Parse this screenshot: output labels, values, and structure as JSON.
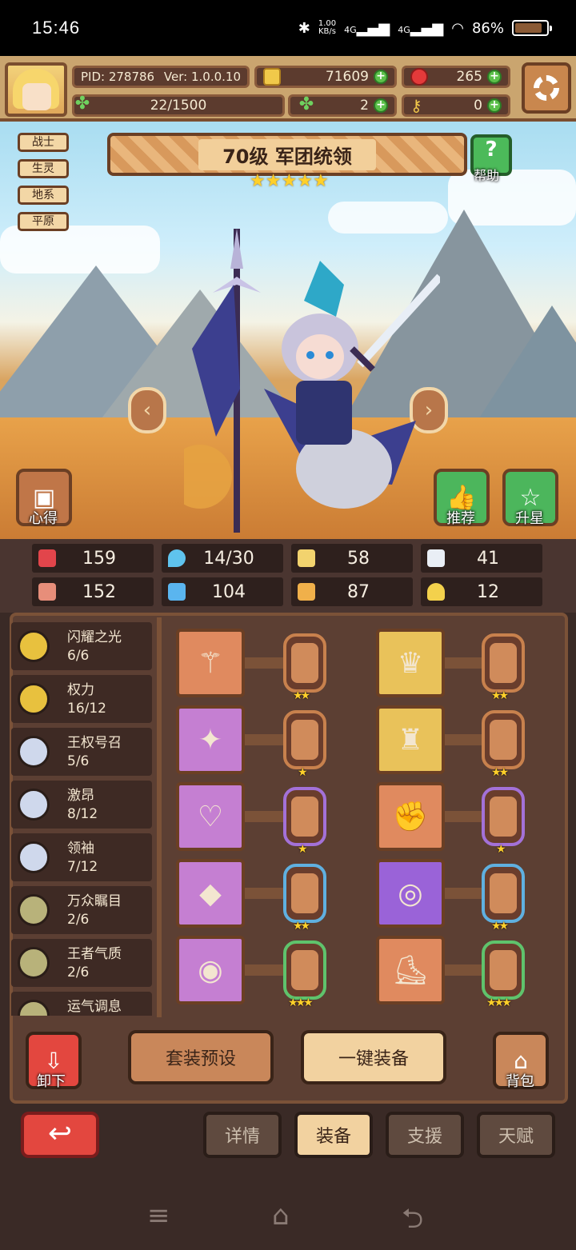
{
  "status_bar": {
    "time": "15:46",
    "net_speed_top": "1.00",
    "net_speed_bottom": "KB/s",
    "signal1": "4G",
    "signal2": "4G",
    "battery": "86%"
  },
  "header": {
    "pid": "PID: 278786",
    "version": "Ver: 1.0.0.10",
    "coins": "71609",
    "gems": "265",
    "stamina": "22/1500",
    "clover": "2",
    "tickets": "0"
  },
  "tags": [
    "战士",
    "生灵",
    "地系",
    "平原"
  ],
  "hero": {
    "title": "70级  军团统领",
    "star_count": 5,
    "help_label": "帮助"
  },
  "side_buttons": {
    "notes": "心得",
    "recommend": "推荐",
    "star_up": "升星"
  },
  "stats": [
    {
      "icon": "heart-icon",
      "value": "159",
      "color": "#e2454b"
    },
    {
      "icon": "drop-icon",
      "value": "14/30",
      "color": "#5fc3ee"
    },
    {
      "icon": "shield-icon",
      "value": "58",
      "color": "#f2d36e"
    },
    {
      "icon": "wing-icon",
      "value": "41",
      "color": "#e9eef5"
    },
    {
      "icon": "fist-icon",
      "value": "152",
      "color": "#e78e7a"
    },
    {
      "icon": "book-icon",
      "value": "104",
      "color": "#5ab5ef"
    },
    {
      "icon": "scroll-icon",
      "value": "87",
      "color": "#f0b04a"
    },
    {
      "icon": "horseshoe-icon",
      "value": "12",
      "color": "#f3d14c"
    }
  ],
  "skills": [
    {
      "name": "闪耀之光",
      "count": "6/6",
      "medal": "#e8c13e"
    },
    {
      "name": "权力",
      "count": "16/12",
      "medal": "#e8c13e"
    },
    {
      "name": "王权号召",
      "count": "5/6",
      "medal": "#cfd8ec"
    },
    {
      "name": "激昂",
      "count": "8/12",
      "medal": "#cfd8ec"
    },
    {
      "name": "领袖",
      "count": "7/12",
      "medal": "#cfd8ec"
    },
    {
      "name": "万众瞩目",
      "count": "2/6",
      "medal": "#b8b27a"
    },
    {
      "name": "王者气质",
      "count": "2/6",
      "medal": "#b8b27a"
    },
    {
      "name": "运气调息",
      "count": "",
      "medal": "#b8b27a"
    }
  ],
  "equipment": [
    {
      "slot": "scepter-icon",
      "bg": "#e08a5f",
      "rune_color": "#c8814d",
      "rune_stars": "★★"
    },
    {
      "slot": "crown-icon",
      "bg": "#e9c25a",
      "rune_color": "#c8814d",
      "rune_stars": "★★"
    },
    {
      "slot": "amulet-icon",
      "bg": "#c57fd2",
      "rune_color": "#c8814d",
      "rune_stars": "★"
    },
    {
      "slot": "cape-icon",
      "bg": "#e9c25a",
      "rune_color": "#c8814d",
      "rune_stars": "★★"
    },
    {
      "slot": "necklace-icon",
      "bg": "#c57fd2",
      "rune_color": "#a371d8",
      "rune_stars": "★"
    },
    {
      "slot": "gauntlet-icon",
      "bg": "#e08a5f",
      "rune_color": "#a371d8",
      "rune_stars": "★"
    },
    {
      "slot": "gem-icon",
      "bg": "#c57fd2",
      "rune_color": "#5fb0e0",
      "rune_stars": "★★"
    },
    {
      "slot": "ring-icon",
      "bg": "#9a63d8",
      "rune_color": "#5fb0e0",
      "rune_stars": "★★"
    },
    {
      "slot": "orb-icon",
      "bg": "#c57fd2",
      "rune_color": "#5fc36c",
      "rune_stars": "★★★"
    },
    {
      "slot": "boots-icon",
      "bg": "#e08a5f",
      "rune_color": "#5fc36c",
      "rune_stars": "★★★"
    }
  ],
  "actions": {
    "unequip": "卸下",
    "preset": "套装预设",
    "auto_equip": "一键装备",
    "bag": "背包"
  },
  "tabs": [
    {
      "label": "详情",
      "active": false
    },
    {
      "label": "装备",
      "active": true
    },
    {
      "label": "支援",
      "active": false
    },
    {
      "label": "天赋",
      "active": false
    }
  ]
}
